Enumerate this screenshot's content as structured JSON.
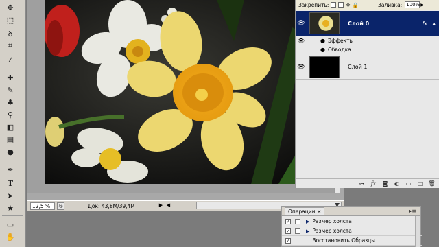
{
  "status": {
    "zoom": "12,5 %",
    "doc_info": "Док: 43,8M/39,4M"
  },
  "layers_panel": {
    "lock_label": "Закрепить:",
    "fill_label": "Заливка:",
    "fill_value": "100%",
    "layers": [
      {
        "name": "Слой 0",
        "selected": true,
        "fx_badge": "fx"
      },
      {
        "name": "Слой 1",
        "selected": false
      }
    ],
    "effects_label": "Эффекты",
    "stroke_label": "Обводка",
    "bottom_icons": [
      "link-icon",
      "fx-icon",
      "mask-icon",
      "adjustment-icon",
      "group-icon",
      "new-layer-icon",
      "trash-icon"
    ]
  },
  "actions_panel": {
    "tab_label": "Операции",
    "rows": [
      {
        "label": "Размер холста"
      },
      {
        "label": "Размер холста"
      },
      {
        "label": "Восстановить Образцы"
      }
    ]
  },
  "colors": {
    "selection_blue": "#0a246a",
    "panel_bg": "#e8e8e8",
    "workspace_gray": "#7b7b7b",
    "toolbox_bg": "#d4d0c8"
  }
}
